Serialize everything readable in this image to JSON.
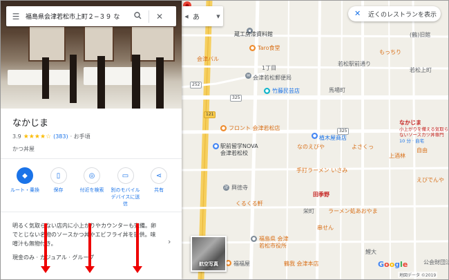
{
  "search": {
    "value": "福島県会津若松市上町２−３９ な"
  },
  "language": {
    "value": "あ"
  },
  "restaurants_button": {
    "label": "近くのレストランを表示"
  },
  "place": {
    "name": "なかじま",
    "rating": "3.9",
    "stars": "★★★★☆",
    "review_count": "(383)",
    "price": "· お手頃",
    "category": "かつ丼屋",
    "description": "明るく気取らない店内に小上がりやカウンターも完備。卵でとじない名物のソースかつ丼やエビフライ丼を提供。味噌汁も無物付き。",
    "tags": "現金のみ · カジュアル · グループ"
  },
  "actions": [
    {
      "icon": "directions-icon",
      "label": "ルート・乗換"
    },
    {
      "icon": "bookmark-icon",
      "label": "保存"
    },
    {
      "icon": "nearby-icon",
      "label": "付近を検索"
    },
    {
      "icon": "send-to-phone-icon",
      "label": "別のモバイルデバイスに送信"
    },
    {
      "icon": "share-icon",
      "label": "共有"
    }
  ],
  "map": {
    "labels": {
      "kura_museum": "蔵工房漆資料館",
      "taro": "Taro食堂",
      "palu": "会津バル",
      "chome1": "1丁目",
      "kita_pub": "会津若松郵便局",
      "takecho": "竹藤民芸店",
      "baba": "馬場町",
      "wakamatsu_ekimae": "若松駅前通り",
      "motcuri": "もっちり",
      "hohouen": "(鶴)旧館",
      "wakamatsu1": "若松上町",
      "front": "フロント 会津若松店",
      "nova": "駅前留学NOVA\n会津若松校",
      "uekiya": "植木屋商店",
      "nanoemi": "なのえびや",
      "yokozo": "よさくっ",
      "kami_sakiya": "上酒林",
      "ebidenya": "えびでんや",
      "ramen_izami": "手打ラーメン いさみ",
      "koushin": "興徳寺",
      "kurukuru": "くるくる軒",
      "tatego": "田季野",
      "eimachi": "栄町",
      "ramen_aoba": "ラーメン処あおやま",
      "kushisen": "串せん",
      "fukushima_pref": "福島県 会津\n若松市役所",
      "honten": "鶴我 会津本店",
      "ryorinoya": "福福屋",
      "koukai": "公会財団法",
      "nakajima_pin": "なかじま",
      "nakajima_desc": "小上がりを備える気取らないソースカツ丼専門",
      "nakajima_hours": "10 分 · 自宅",
      "kasugo": "鯉大",
      "jiyu": "自由"
    },
    "road_shields": {
      "r252": "252",
      "r121": "121",
      "r325a": "325",
      "r325b": "325"
    },
    "photo_label": "航空写真",
    "google": "Google",
    "attribution": "地図データ ©2019"
  },
  "colors": {
    "accent": "#1a73e8",
    "pin_red": "#ea4335",
    "road_yellow": "#f6c94b"
  }
}
